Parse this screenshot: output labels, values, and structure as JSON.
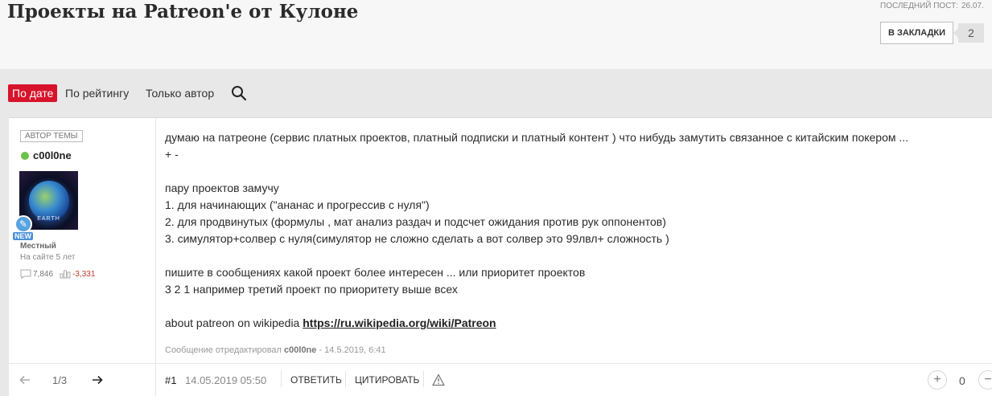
{
  "thread": {
    "title": "Проекты на Patreon'е от Кулоне",
    "last_post_label": "ПОСЛЕДНИЙ ПОСТ:",
    "last_post_value": "26.07.",
    "bookmark_label": "В ЗАКЛАДКИ",
    "bookmark_count": "2"
  },
  "sort_tabs": [
    {
      "label": "По дате",
      "active": true
    },
    {
      "label": "По рейтингу",
      "active": false
    },
    {
      "label": "Только автор",
      "active": false
    }
  ],
  "post": {
    "author_badge": "АВТОР ТЕМЫ",
    "username": "c00l0ne",
    "avatar_caption": "EARTH",
    "rank_badge": "NEW",
    "user_rank": "Местный",
    "member_since": "На сайте 5 лет",
    "message_count": "7,846",
    "reputation": "-3,331",
    "message_lines": [
      "думаю на патреоне (сервис платных проектов, платный подписки и платный контент ) что нибудь замутить связанное с китайским покером ...",
      "+ -",
      "",
      "пару проектов замучу",
      "1. для начинающих (\"ананас и прогрессив с нуля\")",
      "2. для продвинутых (формулы , мат анализ раздач и подсчет ожидания против рук оппонентов)",
      "3. симулятор+солвер с нуля(симулятор не сложно сделать а вот солвер это 99лвл+ сложность )",
      "",
      "пишите в сообщениях какой проект более интересен ... или приоритет проектов",
      "3 2 1 например третий проект по приоритету выше всех",
      ""
    ],
    "link_prefix": "about patreon on wikipedia ",
    "link_text": "https://ru.wikipedia.org/wiki/Patreon",
    "edited_prefix": "Сообщение отредактировал ",
    "edited_user": "c00l0ne",
    "edited_suffix": " - 14.5.2019, 6:41"
  },
  "footer": {
    "pager": "1/3",
    "post_number": "#1",
    "post_date": "14.05.2019 05:50",
    "reply_label": "ОТВЕТИТЬ",
    "quote_label": "ЦИТИРОВАТЬ",
    "vote_count": "0"
  },
  "colors": {
    "accent": "#d7132b",
    "online": "#6cc24a",
    "negative": "#c0392b"
  }
}
